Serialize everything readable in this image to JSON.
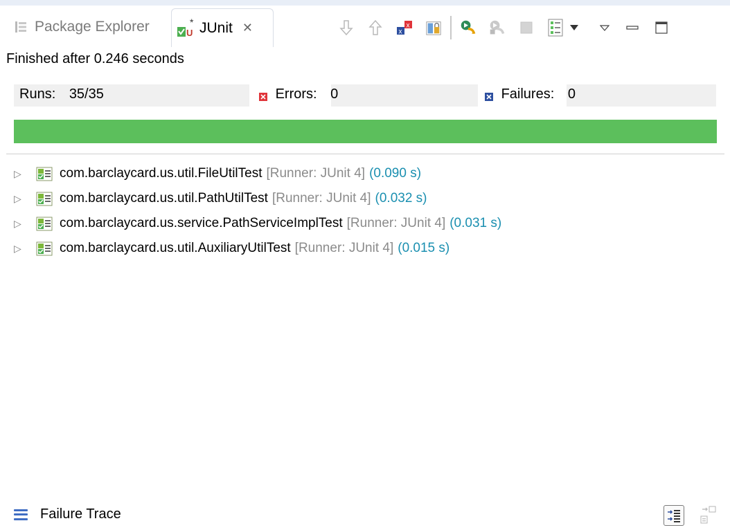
{
  "tabs": [
    {
      "label": "Package Explorer",
      "icon": "package-explorer-icon",
      "active": false
    },
    {
      "label": "JUnit",
      "icon": "junit-icon",
      "active": true,
      "close": "✕"
    }
  ],
  "toolbar_icons": [
    "next-failure-icon",
    "previous-failure-icon",
    "show-failures-only-icon",
    "scroll-lock-icon",
    "rerun-test-icon",
    "rerun-failures-first-icon",
    "stop-icon",
    "test-run-history-icon",
    "history-dropdown-icon",
    "view-menu-icon",
    "minimize-icon",
    "maximize-icon"
  ],
  "status": "Finished after 0.246 seconds",
  "counters": {
    "runs_label": "Runs:",
    "runs_value": "35/35",
    "errors_label": "Errors:",
    "errors_value": "0",
    "failures_label": "Failures:",
    "failures_value": "0"
  },
  "progress": {
    "fraction": 1.0,
    "color": "#5cbf5c"
  },
  "tests": [
    {
      "name": "com.barclaycard.us.util.FileUtilTest",
      "runner": "[Runner: JUnit 4]",
      "time": "(0.090 s)"
    },
    {
      "name": "com.barclaycard.us.util.PathUtilTest",
      "runner": "[Runner: JUnit 4]",
      "time": "(0.032 s)"
    },
    {
      "name": "com.barclaycard.us.service.PathServiceImplTest",
      "runner": "[Runner: JUnit 4]",
      "time": "(0.031 s)"
    },
    {
      "name": "com.barclaycard.us.util.AuxiliaryUtilTest",
      "runner": "[Runner: JUnit 4]",
      "time": "(0.015 s)"
    }
  ],
  "failure_trace": {
    "label": "Failure Trace"
  },
  "colors": {
    "pass": "#5cbf5c",
    "error": "#e0343a",
    "failure": "#2d4fa0",
    "time": "#1a8fb0",
    "runner": "#8b8b8b"
  }
}
